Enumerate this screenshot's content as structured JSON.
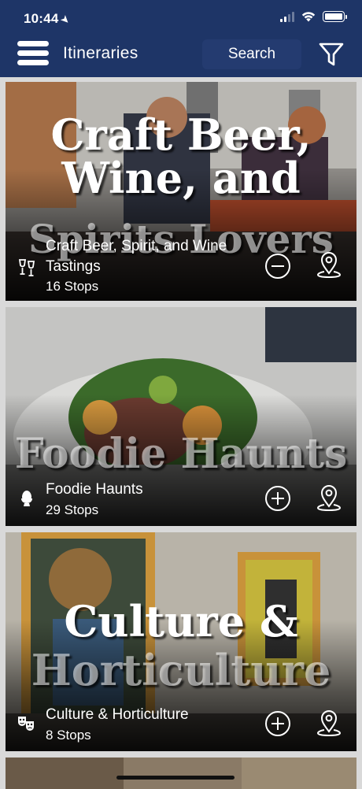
{
  "status_bar": {
    "time": "10:44"
  },
  "header": {
    "title": "Itineraries",
    "search_label": "Search"
  },
  "cards": [
    {
      "hero_lines": [
        "Craft Beer,",
        "Wine, and",
        "Spirits Lovers"
      ],
      "name": "Craft Beer, Spirit, and Wine Tastings",
      "stops": "16 Stops",
      "added": true,
      "category_icon": "wine-glasses-icon"
    },
    {
      "hero_lines": [
        "Foodie Haunts"
      ],
      "name": "Foodie Haunts",
      "stops": "29 Stops",
      "added": false,
      "category_icon": "egg-cup-icon"
    },
    {
      "hero_lines": [
        "Culture &",
        "Horticulture"
      ],
      "name": "Culture & Horticulture",
      "stops": "8 Stops",
      "added": false,
      "category_icon": "theater-masks-icon"
    }
  ],
  "colors": {
    "header_bg": "#1e3567",
    "search_bg": "#243b70",
    "list_bg": "#d9d9d9"
  }
}
